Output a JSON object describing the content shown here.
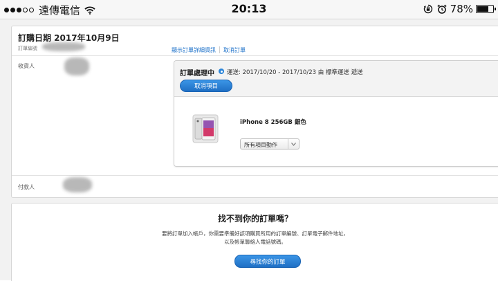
{
  "status_bar": {
    "carrier": "遠傳電信",
    "time": "20:13",
    "battery_percent": "78%",
    "battery_level": 0.78,
    "signal_bars_filled": 3,
    "signal_bars_total": 5,
    "icons": [
      "wifi-icon",
      "orientation-lock-icon",
      "alarm-icon",
      "battery-icon"
    ]
  },
  "order": {
    "title": "訂購日期 2017年10月9日",
    "order_number_label": "訂單編號",
    "links": {
      "show_details": "顯示訂單詳細資訊",
      "cancel_order": "取消訂單"
    },
    "recipient_label": "收貨人",
    "payer_label": "付款人"
  },
  "shipment": {
    "status": "訂單處理中",
    "delivery": "運送: 2017/10/20 - 2017/10/23 由 標準運送 遞送",
    "cancel_item_label": "取消項目",
    "product_name": "iPhone 8 256GB 銀色",
    "actions_select": "所有項目動作"
  },
  "find_order": {
    "title": "找不到你的訂單嗎？",
    "desc_line1": "要將訂單加入帳戶，你需要準備好該項購買所用的訂單編號、訂單電子郵件地址，",
    "desc_line2": "以及帳單聯絡人電話號碼。",
    "button_label": "尋找你的訂單"
  },
  "colors": {
    "accent": "#1f6fc4",
    "link": "#1a6fc8",
    "page_bg": "#f2f2f2"
  }
}
